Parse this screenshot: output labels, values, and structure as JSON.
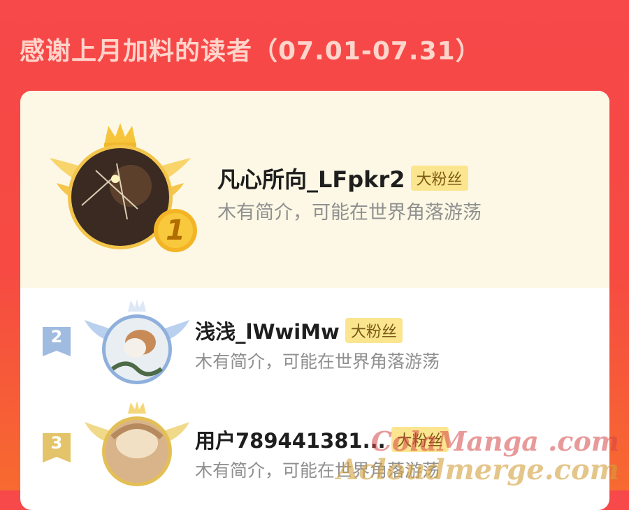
{
  "header": {
    "title": "感谢上月加料的读者（07.01-07.31）"
  },
  "readers": [
    {
      "rank": "1",
      "name": "凡心所向_LFpkr2",
      "badge": "大粉丝",
      "bio": "木有简介，可能在世界角落游荡"
    },
    {
      "rank": "2",
      "name": "浅浅_lWwiMw",
      "badge": "大粉丝",
      "bio": "木有简介，可能在世界角落游荡"
    },
    {
      "rank": "3",
      "name": "用户789441381...",
      "badge": "大粉丝",
      "bio": "木有简介，可能在世界角落游荡"
    }
  ],
  "watermark": {
    "line1": "ColaManga .com",
    "line2": "Acloudmerge.com"
  },
  "colors": {
    "gold": "#f5c33b",
    "silver": "#9fbbe0",
    "bronze": "#e4c46a",
    "badge_bg": "#fbe58f"
  },
  "icons": [
    "crown-icon",
    "wings-icon",
    "rank-medal-icon",
    "rank-ribbon-icon"
  ]
}
